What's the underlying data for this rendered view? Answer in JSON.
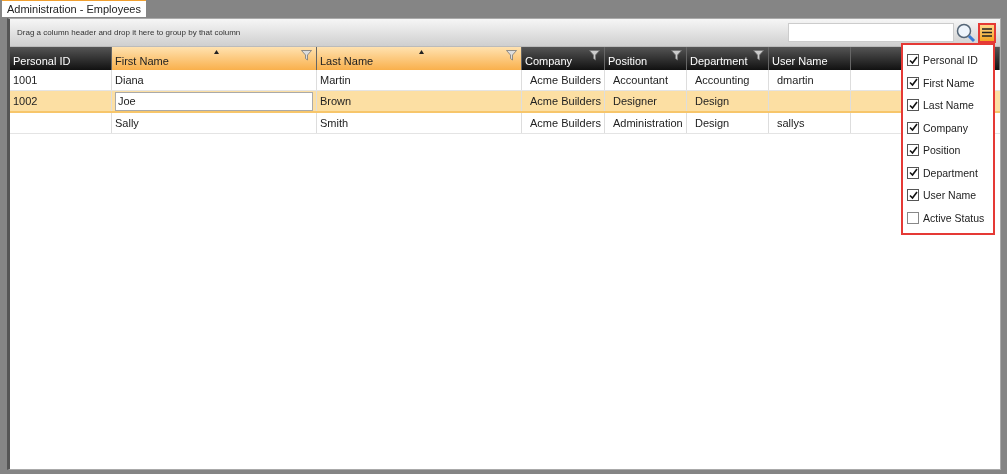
{
  "tab": {
    "label": "Administration - Employees",
    "selected": true
  },
  "group_panel": {
    "hint": "Drag a column header and drop it here to group by that column"
  },
  "columns": [
    {
      "label": "Personal ID",
      "sorted": false,
      "filter": false
    },
    {
      "label": "First Name",
      "sorted": true,
      "filter": true
    },
    {
      "label": "Last Name",
      "sorted": true,
      "filter": true
    },
    {
      "label": "Company",
      "sorted": false,
      "filter": true
    },
    {
      "label": "Position",
      "sorted": false,
      "filter": true
    },
    {
      "label": "Department",
      "sorted": false,
      "filter": true
    },
    {
      "label": "User Name",
      "sorted": false,
      "filter": false
    }
  ],
  "rows": [
    {
      "selected": false,
      "cells": [
        {
          "text": "1001",
          "editing": false
        },
        {
          "text": "Diana",
          "editing": false
        },
        {
          "text": "Martin",
          "editing": false
        },
        {
          "text": "Acme Builders",
          "editing": false
        },
        {
          "text": "Accountant",
          "editing": false
        },
        {
          "text": "Accounting",
          "editing": false
        },
        {
          "text": "dmartin",
          "editing": false
        }
      ]
    },
    {
      "selected": true,
      "cells": [
        {
          "text": "1002",
          "editing": false
        },
        {
          "text": "Joe",
          "editing": true
        },
        {
          "text": "Brown",
          "editing": false
        },
        {
          "text": "Acme Builders",
          "editing": false
        },
        {
          "text": "Designer",
          "editing": false
        },
        {
          "text": "Design",
          "editing": false
        },
        null
      ]
    },
    {
      "selected": false,
      "cells": [
        null,
        {
          "text": "Sally",
          "editing": false
        },
        {
          "text": "Smith",
          "editing": false
        },
        {
          "text": "Acme Builders",
          "editing": false
        },
        {
          "text": "Administration",
          "editing": false
        },
        {
          "text": "Design",
          "editing": false
        },
        {
          "text": "sallys",
          "editing": false
        }
      ]
    }
  ],
  "column_chooser": {
    "expanded": true,
    "items": [
      {
        "label": "Personal ID",
        "checked": true
      },
      {
        "label": "First Name",
        "checked": true
      },
      {
        "label": "Last Name",
        "checked": true
      },
      {
        "label": "Company",
        "checked": true
      },
      {
        "label": "Position",
        "checked": true
      },
      {
        "label": "Department",
        "checked": true
      },
      {
        "label": "User Name",
        "checked": true
      },
      {
        "label": "Active Status",
        "checked": false
      }
    ]
  }
}
